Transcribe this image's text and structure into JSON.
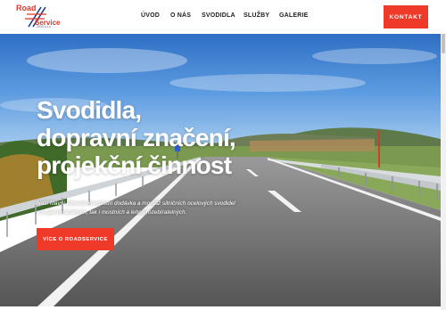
{
  "header": {
    "logo": {
      "line1": "Road",
      "line2": "Service",
      "line3": "2010 s.r.o."
    },
    "nav": [
      {
        "label": "ÚVOD"
      },
      {
        "label": "O NÁS"
      },
      {
        "label": "SVODIDLA"
      },
      {
        "label": "SLUŽBY"
      },
      {
        "label": "GALERIE"
      }
    ],
    "contact_label": "KONTAKT"
  },
  "hero": {
    "title_lines": [
      "Svodidla,",
      "dopravní značení,",
      "projekční činnost"
    ],
    "description_lines": [
      "Naší hlavní činností kompletní dodávka a montáž silničních ocelových svodidel",
      "a to jak beraněných, tak i mostních a lehce rozebíratelných."
    ],
    "cta_label": "VÍCE O ROADSERVICE"
  },
  "colors": {
    "accent": "#ef3a2a",
    "logo_blue": "#1a3a8a",
    "sky": "#4a8fd8",
    "asphalt": "#6e6e6e"
  }
}
